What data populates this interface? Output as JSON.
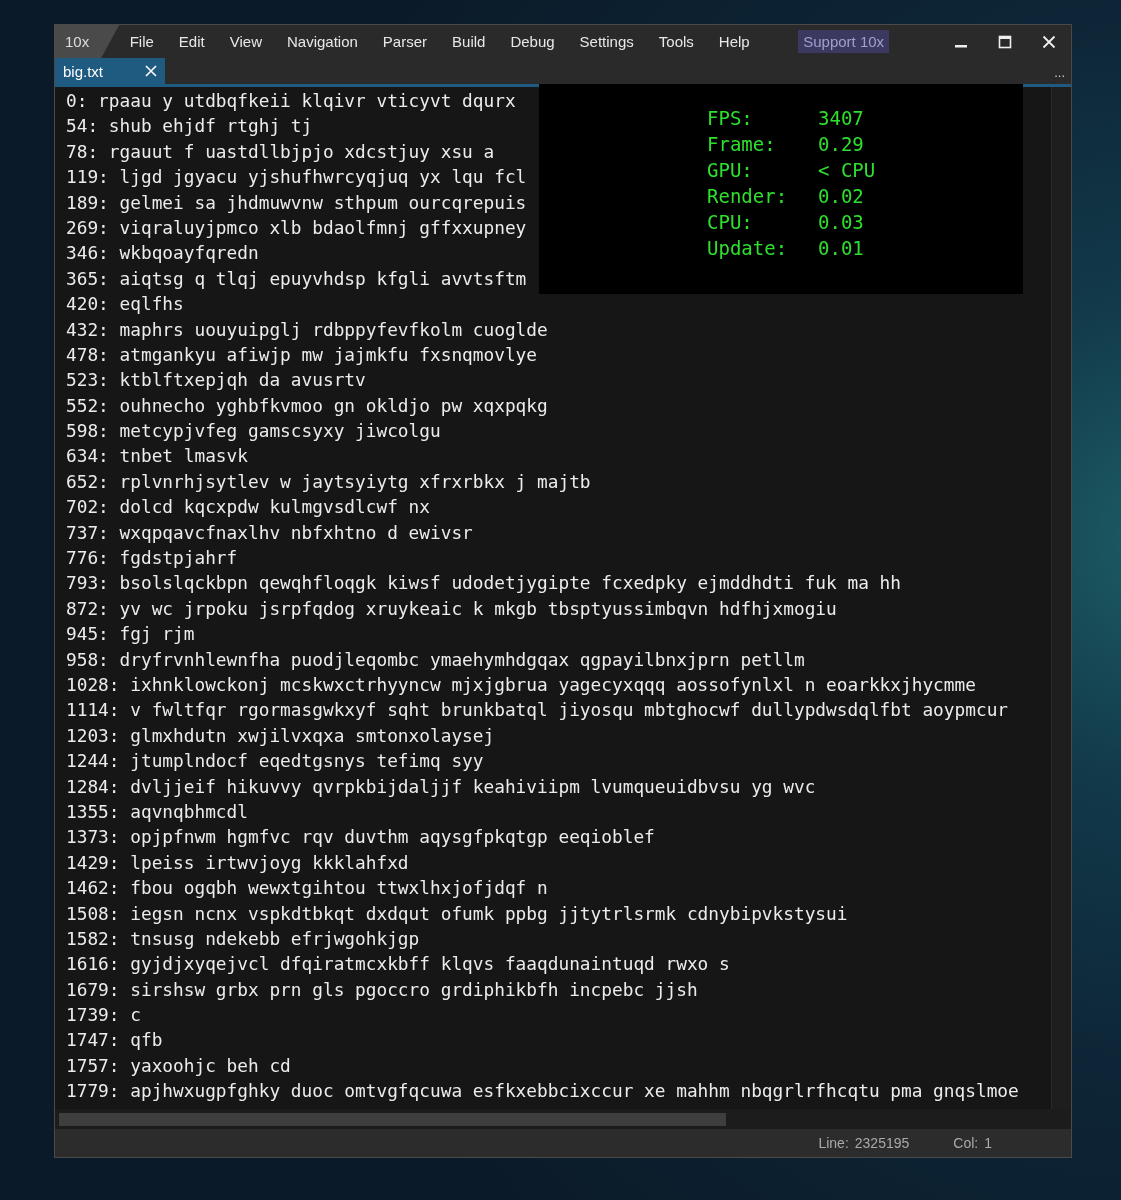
{
  "window": {
    "app_name": "10x",
    "menu": [
      "File",
      "Edit",
      "View",
      "Navigation",
      "Parser",
      "Build",
      "Debug",
      "Settings",
      "Tools",
      "Help"
    ],
    "support_button": "Support 10x"
  },
  "tabs": [
    {
      "label": "big.txt",
      "selected": true
    }
  ],
  "tab_overflow": "...",
  "editor": {
    "lines": [
      "0: rpaau y utdbqfkeii klqivr vticyvt dqurx",
      "54: shub ehjdf rtghj tj",
      "78: rgauut f uastdllbjpjo xdcstjuy xsu a",
      "119: ljgd jgyacu yjshufhwrcyqjuq yx lqu fcl",
      "189: gelmei sa jhdmuwvnw sthpum ourcqrepuis",
      "269: viqraluyjpmco xlb bdaolfmnj gffxxupney",
      "346: wkbqoayfqredn",
      "365: aiqtsg q tlqj epuyvhdsp kfgli avvtsftm",
      "420: eqlfhs",
      "432: maphrs uouyuipglj rdbppyfevfkolm cuoglde",
      "478: atmgankyu afiwjp mw jajmkfu fxsnqmovlye",
      "523: ktblftxepjqh da avusrtv",
      "552: ouhnecho yghbfkvmoo gn okldjo pw xqxpqkg",
      "598: metcypjvfeg gamscsyxy jiwcolgu",
      "634: tnbet lmasvk",
      "652: rplvnrhjsytlev w jaytsyiytg xfrxrbkx j majtb",
      "702: dolcd kqcxpdw kulmgvsdlcwf nx",
      "737: wxqpqavcfnaxlhv nbfxhtno d ewivsr",
      "776: fgdstpjahrf",
      "793: bsolslqckbpn qewqhfloqgk kiwsf udodetjygipte fcxedpky ejmddhdti fuk ma hh",
      "872: yv wc jrpoku jsrpfqdog xruykeaic k mkgb tbsptyussimbqvn hdfhjxmogiu",
      "945: fgj rjm",
      "958: dryfrvnhlewnfha puodjleqombc ymaehymhdgqax qgpayilbnxjprn petllm",
      "1028: ixhnklowckonj mcskwxctrhyyncw mjxjgbrua yagecyxqqq aossofynlxl n eoarkkxjhycmme",
      "1114: v fwltfqr rgormasgwkxyf sqht brunkbatql jiyosqu mbtghocwf dullypdwsdqlfbt aoypmcur",
      "1203: glmxhdutn xwjilvxqxa smtonxolaysej",
      "1244: jtumplndocf eqedtgsnys tefimq syy",
      "1284: dvljjeif hikuvvy qvrpkbijdaljjf keahiviipm lvumqueuidbvsu yg wvc",
      "1355: aqvnqbhmcdl",
      "1373: opjpfnwm hgmfvc rqv duvthm aqysgfpkqtgp eeqioblef",
      "1429: lpeiss irtwvjoyg kkklahfxd",
      "1462: fbou ogqbh wewxtgihtou ttwxlhxjofjdqf n",
      "1508: iegsn ncnx vspkdtbkqt dxdqut ofumk ppbg jjtytrlsrmk cdnybipvkstysui",
      "1582: tnsusg ndekebb efrjwgohkjgp",
      "1616: gyjdjxyqejvcl dfqiratmcxkbff klqvs faaqdunaintuqd rwxo s",
      "1679: sirshsw grbx prn gls pgoccro grdiphikbfh incpebc jjsh",
      "1739: c",
      "1747: qfb",
      "1757: yaxoohjc beh cd",
      "1779: apjhwxugpfghky duoc omtvgfqcuwa esfkxebbcixccur xe mahhm nbqgrlrfhcqtu pma gnqslmoe"
    ]
  },
  "stats_overlay": {
    "rows": [
      {
        "label": "FPS:",
        "value": "3407"
      },
      {
        "label": "Frame:",
        "value": "0.29"
      },
      {
        "label": "GPU:",
        "value": "< CPU"
      },
      {
        "label": "Render:",
        "value": "0.02"
      },
      {
        "label": "CPU:",
        "value": "0.03"
      },
      {
        "label": "Update:",
        "value": "0.01"
      }
    ]
  },
  "status_bar": {
    "line_label": "Line:",
    "line_value": "2325195",
    "col_label": "Col:",
    "col_value": "1"
  }
}
